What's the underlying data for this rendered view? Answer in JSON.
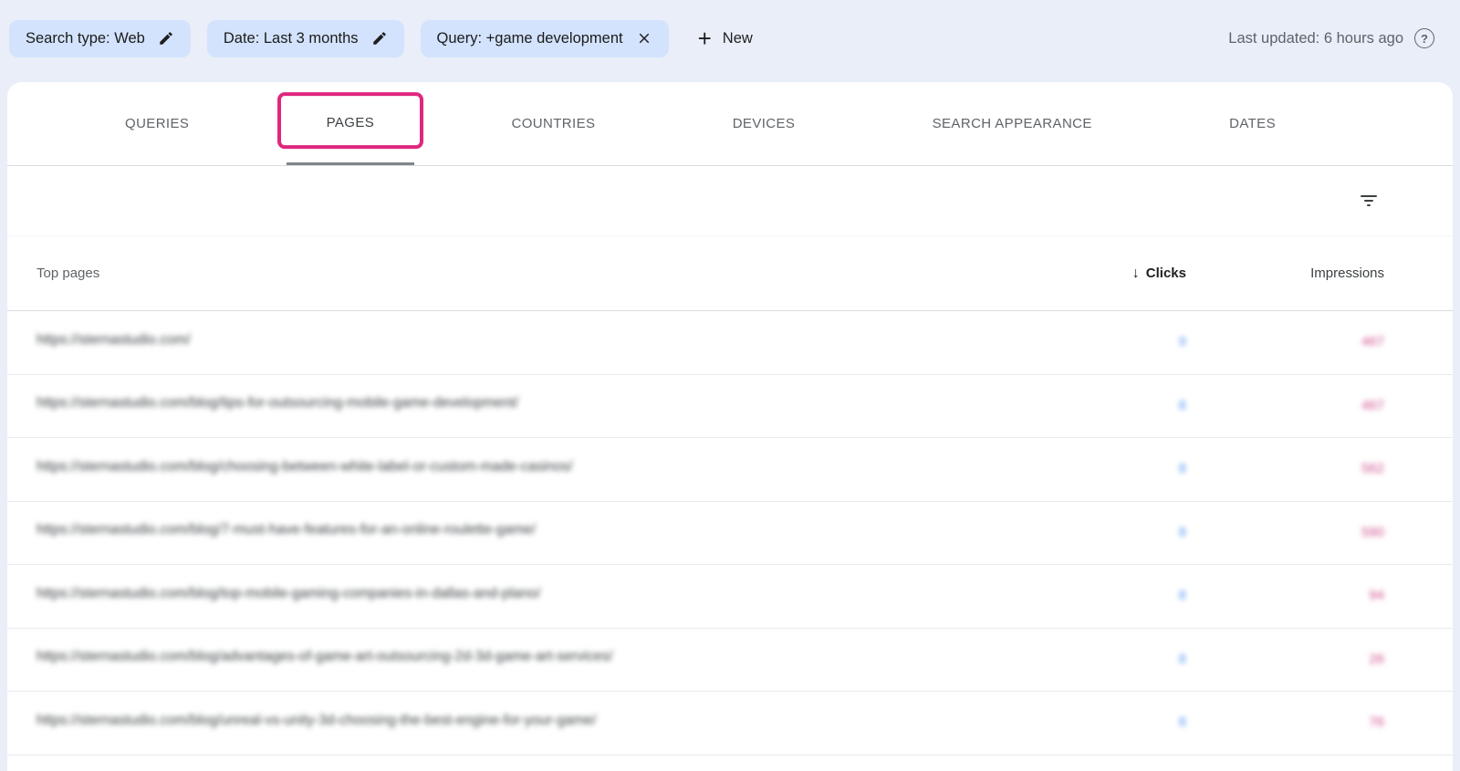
{
  "topbar": {
    "chips": [
      {
        "label": "Search type: Web",
        "action": "edit"
      },
      {
        "label": "Date: Last 3 months",
        "action": "edit"
      },
      {
        "label": "Query: +game development",
        "action": "remove"
      }
    ],
    "new_label": "New",
    "plus_glyph": "+",
    "last_updated": "Last updated: 6 hours ago",
    "help_glyph": "?"
  },
  "tabs": [
    {
      "label": "QUERIES"
    },
    {
      "label": "PAGES"
    },
    {
      "label": "COUNTRIES"
    },
    {
      "label": "DEVICES"
    },
    {
      "label": "SEARCH APPEARANCE"
    },
    {
      "label": "DATES"
    }
  ],
  "active_tab": "PAGES",
  "table": {
    "first_column_header": "Top pages",
    "clicks_header": "Clicks",
    "impressions_header": "Impressions",
    "sort_glyph": "↓",
    "rows": [
      {
        "url": "https://sternastudio.com/",
        "clicks": "9",
        "impressions": "467"
      },
      {
        "url": "https://sternastudio.com/blog/tips-for-outsourcing-mobile-game-development/",
        "clicks": "8",
        "impressions": "467"
      },
      {
        "url": "https://sternastudio.com/blog/choosing-between-white-label-or-custom-made-casinos/",
        "clicks": "8",
        "impressions": "562"
      },
      {
        "url": "https://sternastudio.com/blog/7-must-have-features-for-an-online-roulette-game/",
        "clicks": "8",
        "impressions": "590"
      },
      {
        "url": "https://sternastudio.com/blog/top-mobile-gaming-companies-in-dallas-and-plano/",
        "clicks": "8",
        "impressions": "94"
      },
      {
        "url": "https://sternastudio.com/blog/advantages-of-game-art-outsourcing-2d-3d-game-art-services/",
        "clicks": "8",
        "impressions": "26"
      },
      {
        "url": "https://sternastudio.com/blog/unreal-vs-unity-3d-choosing-the-best-engine-for-your-game/",
        "clicks": "8",
        "impressions": "76"
      }
    ]
  },
  "colors": {
    "page_bg": "#e9eef8",
    "chip_bg": "#d3e3fd",
    "card_bg": "#ffffff",
    "highlight_box": "#e0267e",
    "clicks_value": "#5c9bf5",
    "impressions_value": "#cf4d8e"
  }
}
